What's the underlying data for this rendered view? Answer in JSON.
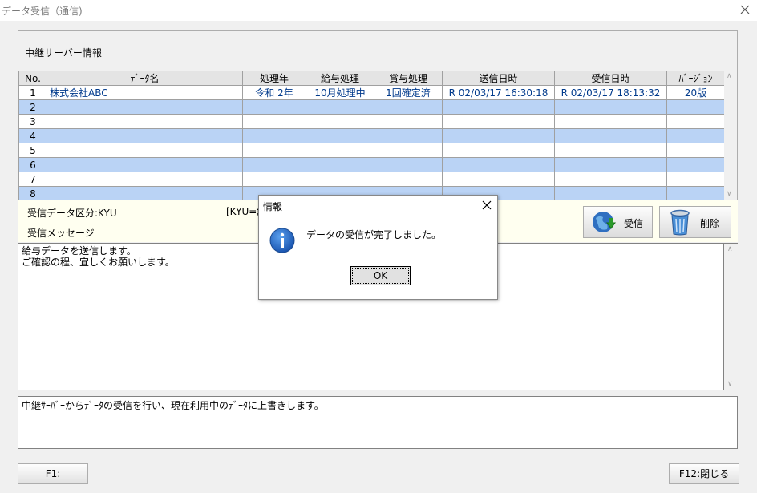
{
  "window": {
    "title": "データ受信（通信)"
  },
  "panel": {
    "title": "中継サーバー情報"
  },
  "grid": {
    "headers": [
      "No.",
      "ﾃﾞｰﾀ名",
      "処理年",
      "給与処理",
      "賞与処理",
      "送信日時",
      "受信日時",
      "ﾊﾞｰｼﾞｮﾝ"
    ],
    "rows": [
      {
        "no": "1",
        "name": "株式会社ABC",
        "year": "令和  2年",
        "salary": "10月処理中",
        "bonus": "1回確定済",
        "sent": "R 02/03/17 16:30:18",
        "received": "R 02/03/17 18:13:32",
        "version": "20版"
      },
      {
        "no": "2"
      },
      {
        "no": "3"
      },
      {
        "no": "4"
      },
      {
        "no": "5"
      },
      {
        "no": "6"
      },
      {
        "no": "7"
      },
      {
        "no": "8"
      }
    ]
  },
  "info": {
    "data_type_label": "受信データ区分:KYU",
    "data_type_note": "[KYU=給",
    "message_label": "受信メッセージ"
  },
  "buttons": {
    "receive": "受信",
    "delete": "削除",
    "f1": "F1:",
    "f12": "F12:閉じる"
  },
  "message": {
    "line1": "給与データを送信します。",
    "line2": "ご確認の程、宜しくお願いします。"
  },
  "description": "中継ｻｰﾊﾞｰからﾃﾞｰﾀの受信を行い、現在利用中のﾃﾞｰﾀに上書きします。",
  "dialog": {
    "title": "情報",
    "message": "データの受信が完了しました。",
    "ok": "OK"
  },
  "icons": {
    "close": "close-icon",
    "info": "info-icon",
    "globe": "globe-download-icon",
    "trash": "trash-icon"
  },
  "colors": {
    "alt_row": "#bad3f5",
    "value_text": "#003a8c"
  }
}
